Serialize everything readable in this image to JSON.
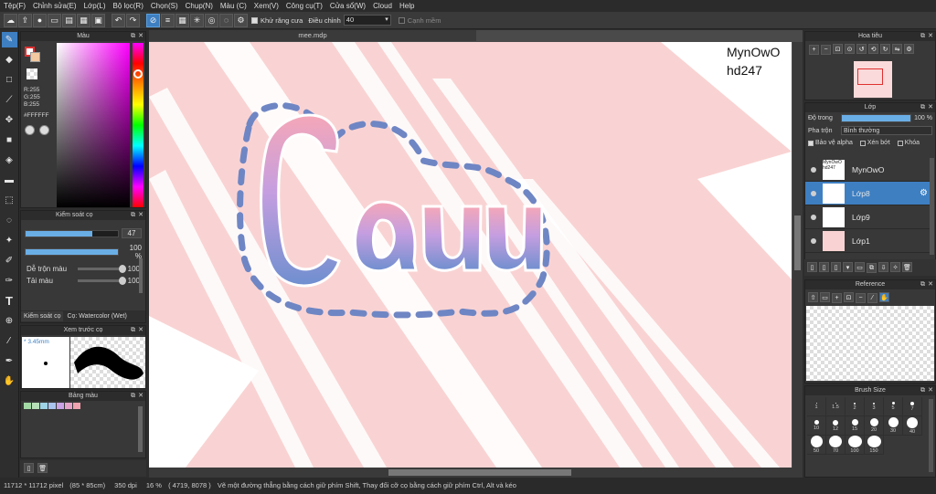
{
  "menu": [
    "Tệp(F)",
    "Chỉnh sửa(E)",
    "Lớp(L)",
    "Bộ lọc(R)",
    "Chọn(S)",
    "Chụp(N)",
    "Màu (C)",
    "Xem(V)",
    "Công cụ(T)",
    "Cửa sổ(W)",
    "Cloud",
    "Help"
  ],
  "toolbar": {
    "antialias_label": "Khử răng cưa",
    "correction_label": "Điều chỉnh",
    "correction_value": "40",
    "edge_label": "Cạnh mềm"
  },
  "doc_tab": "mee.mdp",
  "color_panel": {
    "title": "Màu",
    "rgb_r": "R:255",
    "rgb_g": "G:255",
    "rgb_b": "B:255",
    "hex": "#FFFFFF"
  },
  "brush_control": {
    "title": "Kiểm soát cọ",
    "size_value": "47",
    "size_fraction": 0.72,
    "opacity_value": "100 %",
    "opacity_fraction": 1.0,
    "blend_label": "Dễ trộn màu",
    "blend_value": "100",
    "reload_label": "Tải màu",
    "reload_value": "100",
    "tab_label": "Kiểm soát cọ",
    "brush_name": "Cọ: Watercolor (Wet)"
  },
  "brush_preview": {
    "title": "Xem trước cọ",
    "size": "* 3.45mm"
  },
  "palette": {
    "title": "Bảng màu",
    "swatches": [
      "#a3d9a5",
      "#b8e0b8",
      "#9fd3e6",
      "#a9c4ee",
      "#c9a3e6",
      "#e6a3c9",
      "#f0a3b0"
    ]
  },
  "canvas": {
    "signature_line1": "MynOwO",
    "signature_line2": "hd247",
    "word": "Cau"
  },
  "navigator": {
    "title": "Hoa tiêu"
  },
  "layers": {
    "title": "Lớp",
    "opacity_label": "Độ trong",
    "opacity_value": "100 %",
    "blend_label": "Pha trộn",
    "blend_value": "Bình thường",
    "protect_alpha": "Bảo vệ alpha",
    "clipping": "Xén bớt",
    "lock": "Khóa",
    "items": [
      {
        "name": "MynOwO",
        "thumb": "MynOwO hd247"
      },
      {
        "name": "Lớp8",
        "thumb": ""
      },
      {
        "name": "Lớp9",
        "thumb": ""
      },
      {
        "name": "Lớp1",
        "thumb": ""
      }
    ]
  },
  "reference": {
    "title": "Reference"
  },
  "brush_size": {
    "title": "Brush Size",
    "sizes": [
      "1",
      "1.5",
      "2",
      "3",
      "5",
      "7",
      "10",
      "12",
      "15",
      "20",
      "30",
      "40",
      "50",
      "70",
      "100",
      "150"
    ]
  },
  "status": {
    "dims": "11712 * 11712 pixel",
    "cm": "(85 * 85cm)",
    "dpi": "350 dpi",
    "zoom": "16 %",
    "coords": "( 4719, 8078 )",
    "hint": "Vẽ một đường thẳng bằng cách giữ phím Shift, Thay đổi cỡ cọ bằng cách giữ phím Ctrl, Alt và kéo"
  }
}
